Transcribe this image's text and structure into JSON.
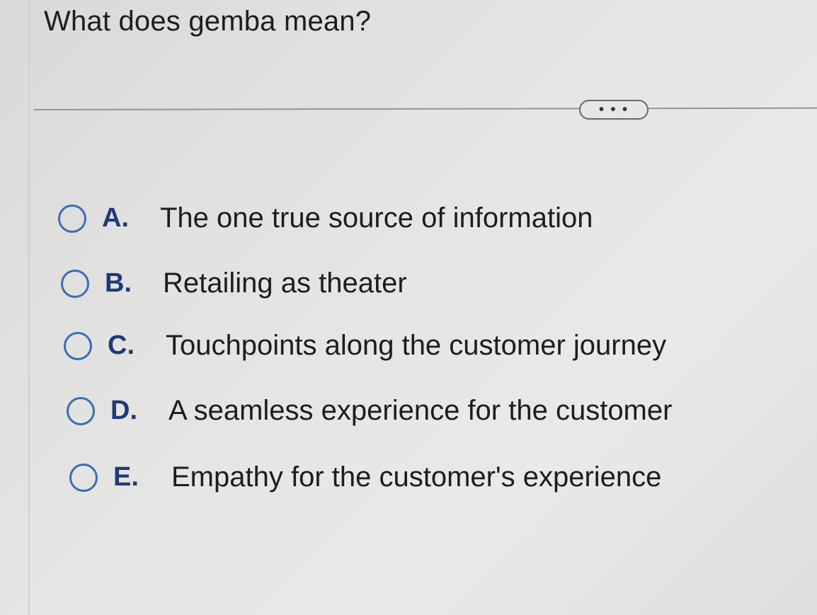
{
  "question": {
    "text": "What does gemba mean?"
  },
  "more_button": {
    "label": "• • •"
  },
  "options": [
    {
      "letter": "A.",
      "text": "The one true source of information"
    },
    {
      "letter": "B.",
      "text": "Retailing as theater"
    },
    {
      "letter": "C.",
      "text": "Touchpoints along the customer journey"
    },
    {
      "letter": "D.",
      "text": "A seamless experience for the customer"
    },
    {
      "letter": "E.",
      "text": "Empathy for the customer's experience"
    }
  ],
  "colors": {
    "radio_border": "#3d6bb8",
    "letter": "#1f3a78",
    "divider": "#8f969c"
  }
}
